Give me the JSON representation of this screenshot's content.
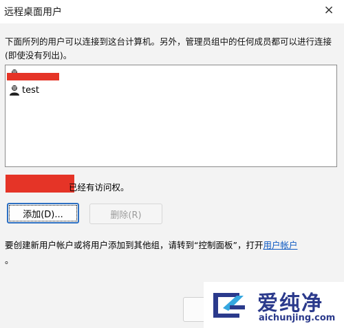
{
  "dialog": {
    "title": "远程桌面用户",
    "close_glyph": "×"
  },
  "description": "下面所列的用户可以连接到这台计算机。另外，管理员组中的任何成员都可以进行连接(即使没有列出)。",
  "users": [
    {
      "label": "",
      "redacted": true
    },
    {
      "label": "test",
      "redacted": false
    }
  ],
  "access": {
    "suffix": "已经有访问权。"
  },
  "buttons": {
    "add": "添加(D)...",
    "remove": "删除(R)"
  },
  "hint": {
    "text": "要创建新用户帐户或将用户添加到其他组，请转到“控制面板”，打开",
    "link": "用户帐户",
    "tail": "。"
  },
  "watermark": {
    "brand": "爱纯净",
    "url": "aichunjing.com"
  },
  "colors": {
    "redaction": "#e53427",
    "link": "#0a57c2",
    "brand": "#2b3a8c"
  }
}
